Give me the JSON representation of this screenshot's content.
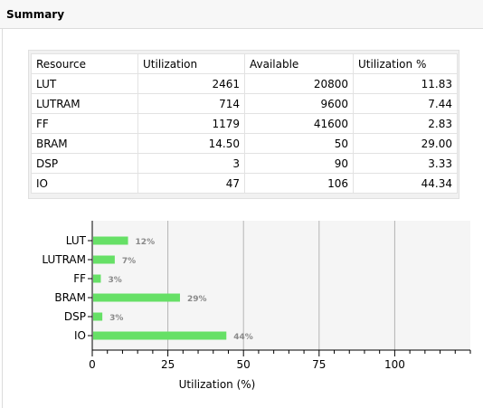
{
  "header": {
    "title": "Summary"
  },
  "table": {
    "columns": [
      "Resource",
      "Utilization",
      "Available",
      "Utilization %"
    ],
    "rows": [
      [
        "LUT",
        "2461",
        "20800",
        "11.83"
      ],
      [
        "LUTRAM",
        "714",
        "9600",
        "7.44"
      ],
      [
        "FF",
        "1179",
        "41600",
        "2.83"
      ],
      [
        "BRAM",
        "14.50",
        "50",
        "29.00"
      ],
      [
        "DSP",
        "3",
        "90",
        "3.33"
      ],
      [
        "IO",
        "47",
        "106",
        "44.34"
      ]
    ]
  },
  "colors": {
    "bar": "#66e066",
    "plot_bg": "#f5f5f5",
    "grid": "#b4b4b4",
    "data_label": "#8a8a8a"
  },
  "chart_data": {
    "type": "bar",
    "orientation": "horizontal",
    "categories": [
      "LUT",
      "LUTRAM",
      "FF",
      "BRAM",
      "DSP",
      "IO"
    ],
    "values": [
      11.83,
      7.44,
      2.83,
      29.0,
      3.33,
      44.34
    ],
    "data_labels": [
      "12%",
      "7%",
      "3%",
      "29%",
      "3%",
      "44%"
    ],
    "xlabel": "Utilization (%)",
    "xlim": [
      0,
      125
    ],
    "xticks": [
      0,
      25,
      50,
      75,
      100
    ],
    "grid": true
  }
}
